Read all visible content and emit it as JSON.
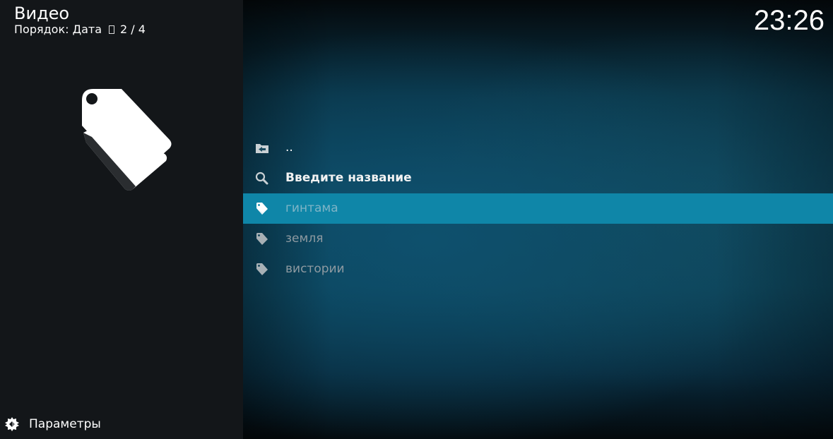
{
  "header": {
    "title": "Видео",
    "sort_label": "Порядок: Дата",
    "position": "2 / 4",
    "clock": "23:26"
  },
  "preview": {
    "icon": "tags-icon"
  },
  "list": {
    "items": [
      {
        "icon": "folder-back-icon",
        "label": ".."
      },
      {
        "icon": "search-icon",
        "label": "Введите название"
      },
      {
        "icon": "tag-icon",
        "label": "гинтама",
        "selected": true
      },
      {
        "icon": "tag-icon",
        "label": "земля"
      },
      {
        "icon": "tag-icon",
        "label": "вистории"
      }
    ]
  },
  "footer": {
    "icon": "gear-icon",
    "label": "Параметры"
  },
  "colors": {
    "selection": "#0f86a8",
    "left_panel": "#131619",
    "dim_text": "#8e9aa1"
  }
}
